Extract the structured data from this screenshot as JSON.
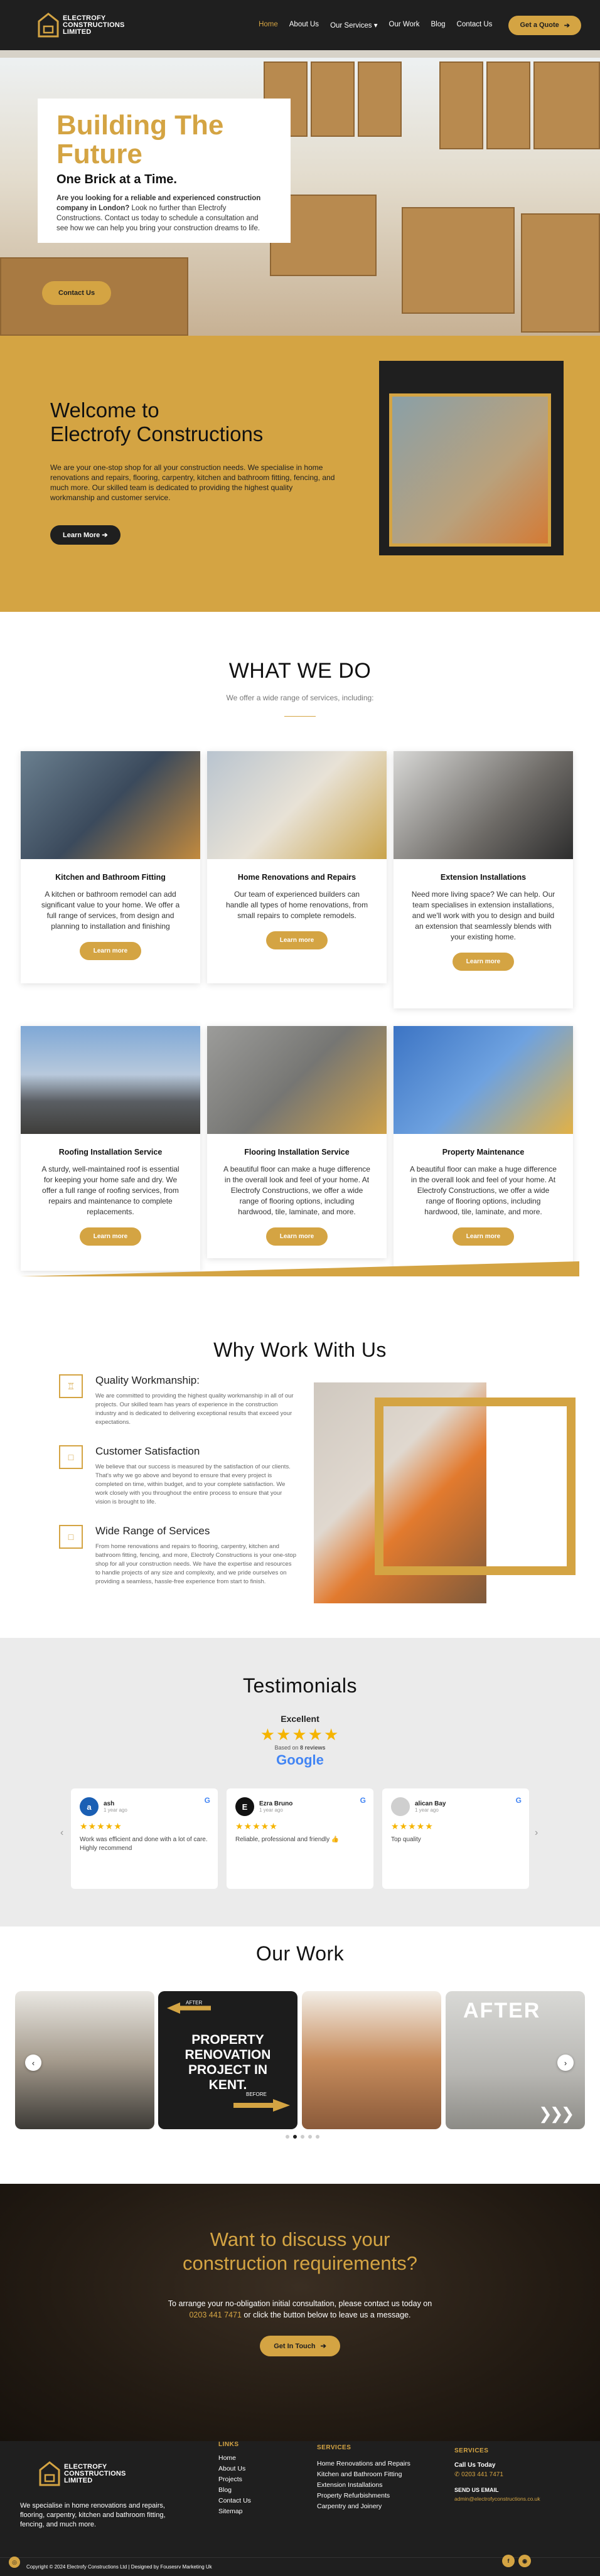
{
  "brand": {
    "name_line1": "ELECTROFY",
    "name_line2": "CONSTRUCTIONS",
    "name_line3": "LIMITED",
    "accent": "#d4a443",
    "dark": "#1f1f1f"
  },
  "nav": {
    "items": [
      "Home",
      "About Us",
      "Our Services",
      "Our Work",
      "Blog",
      "Contact Us"
    ],
    "quote_button": "Get a Quote"
  },
  "hero": {
    "title": "Building The Future",
    "subtitle": "One Brick at a Time.",
    "text_bold": "Are you looking for a reliable and experienced construction company in London?",
    "text": " Look no further than Electrofy Constructions. Contact us today to schedule a consultation and see how we can help you bring your construction dreams to life.",
    "button": "Contact Us"
  },
  "welcome": {
    "title_line1": "Welcome to",
    "title_line2": "Electrofy Constructions",
    "text": "We are your one-stop shop for all your construction needs. We specialise in home renovations and repairs, flooring, carpentry, kitchen and bathroom fitting, fencing, and much more. Our skilled team is dedicated to providing the highest quality workmanship and customer service.",
    "button": "Learn More"
  },
  "services": {
    "title": "WHAT WE DO",
    "subtitle": "We offer a wide range of services, including:",
    "cards": [
      {
        "title": "Kitchen and Bathroom Fitting",
        "text": "A kitchen or bathroom remodel can add significant value to your home. We offer a full range of services, from design and planning to installation and finishing",
        "button": "Learn more"
      },
      {
        "title": "Home Renovations and Repairs",
        "text": "Our team of experienced builders can handle all types of home renovations, from small repairs to complete remodels.",
        "button": "Learn more"
      },
      {
        "title": "Extension Installations",
        "text": "Need more living space? We can help. Our team specialises in extension installations, and we'll work with you to design and build an extension that seamlessly blends with your existing home.",
        "button": "Learn more"
      },
      {
        "title": "Roofing Installation Service",
        "text": "A sturdy, well-maintained roof is essential for keeping your home safe and dry. We offer a full range of roofing services, from repairs and maintenance to complete replacements.",
        "button": "Learn more"
      },
      {
        "title": "Flooring Installation Service",
        "text": "A beautiful floor can make a huge difference in the overall look and feel of your home. At Electrofy Constructions, we offer a wide range of flooring options, including hardwood, tile, laminate, and more.",
        "button": "Learn more"
      },
      {
        "title": "Property Maintenance",
        "text": "A beautiful floor can make a huge difference in the overall look and feel of your home. At Electrofy Constructions, we offer a wide range of flooring options, including hardwood, tile, laminate, and more.",
        "button": "Learn more"
      }
    ]
  },
  "why": {
    "title": "Why Work With Us",
    "items": [
      {
        "title": "Quality Workmanship:",
        "text": "We are committed to providing the highest quality workmanship in all of our projects. Our skilled team has years of experience in the construction industry and is dedicated to delivering exceptional results that exceed your expectations."
      },
      {
        "title": "Customer Satisfaction",
        "text": "We believe that our success is measured by the satisfaction of our clients. That's why we go above and beyond to ensure that every project is completed on time, within budget, and to your complete satisfaction. We work closely with you throughout the entire process to ensure that your vision is brought to life."
      },
      {
        "title": "Wide Range of Services",
        "text": "From home renovations and repairs to flooring, carpentry, kitchen and bathroom fitting, fencing, and more, Electrofy Constructions is your one-stop shop for all your construction needs. We have the expertise and resources to handle projects of any size and complexity, and we pride ourselves on providing a seamless, hassle-free experience from start to finish."
      }
    ]
  },
  "testimonials": {
    "title": "Testimonials",
    "rating_label": "Excellent",
    "based_on_prefix": "Based on ",
    "review_count": "8 reviews",
    "google": "Google",
    "reviews": [
      {
        "initial": "a",
        "name": "ash",
        "date": "1 year ago",
        "text": "Work was efficient and done with a lot of care. Highly recommend",
        "color": "#1a5fb4"
      },
      {
        "initial": "E",
        "name": "Ezra Bruno",
        "date": "1 year ago",
        "text": "Reliable, professional and friendly 👍",
        "color": "#111111"
      },
      {
        "initial": "",
        "name": "alican Bay",
        "date": "1 year ago",
        "text": "Top quality",
        "color": "#cfcfcf"
      }
    ]
  },
  "work": {
    "title": "Our Work",
    "slide2_after": "AFTER",
    "slide2_text": "PROPERTY RENOVATION PROJECT IN KENT.",
    "slide2_before": "BEFORE",
    "slide4_text": "AFTER"
  },
  "cta": {
    "title": "Want to discuss your construction requirements?",
    "text_part1": "To arrange your no-obligation initial consultation, please contact us today on",
    "phone": "0203 441 7471",
    "text_part2": " or click the button below to leave us a message.",
    "button": "Get In Touch"
  },
  "footer": {
    "tagline": "We specialise in home renovations and repairs, flooring, carpentry, kitchen and bathroom fitting, fencing, and much more.",
    "links_heading": "LINKS",
    "links": [
      "Home",
      "About Us",
      "Projects",
      "Blog",
      "Contact Us",
      "Sitemap"
    ],
    "services_heading": "SERVICES",
    "services": [
      "Home Renovations and Repairs",
      "Kitchen and Bathroom Fitting",
      "Extension Installations",
      "Property Refurbishments",
      "Carpentry and Joinery"
    ],
    "contact_heading": "SERVICES",
    "call_label": "Call Us Today",
    "phone": "0203 441 7471",
    "email_label": "SEND US EMAIL",
    "email": "admin@electrofyconstructions.co.uk",
    "copyright": "Copyright © 2024 Electrofy Constructions Ltd | Designed by Fousesrv Marketing Uk"
  }
}
